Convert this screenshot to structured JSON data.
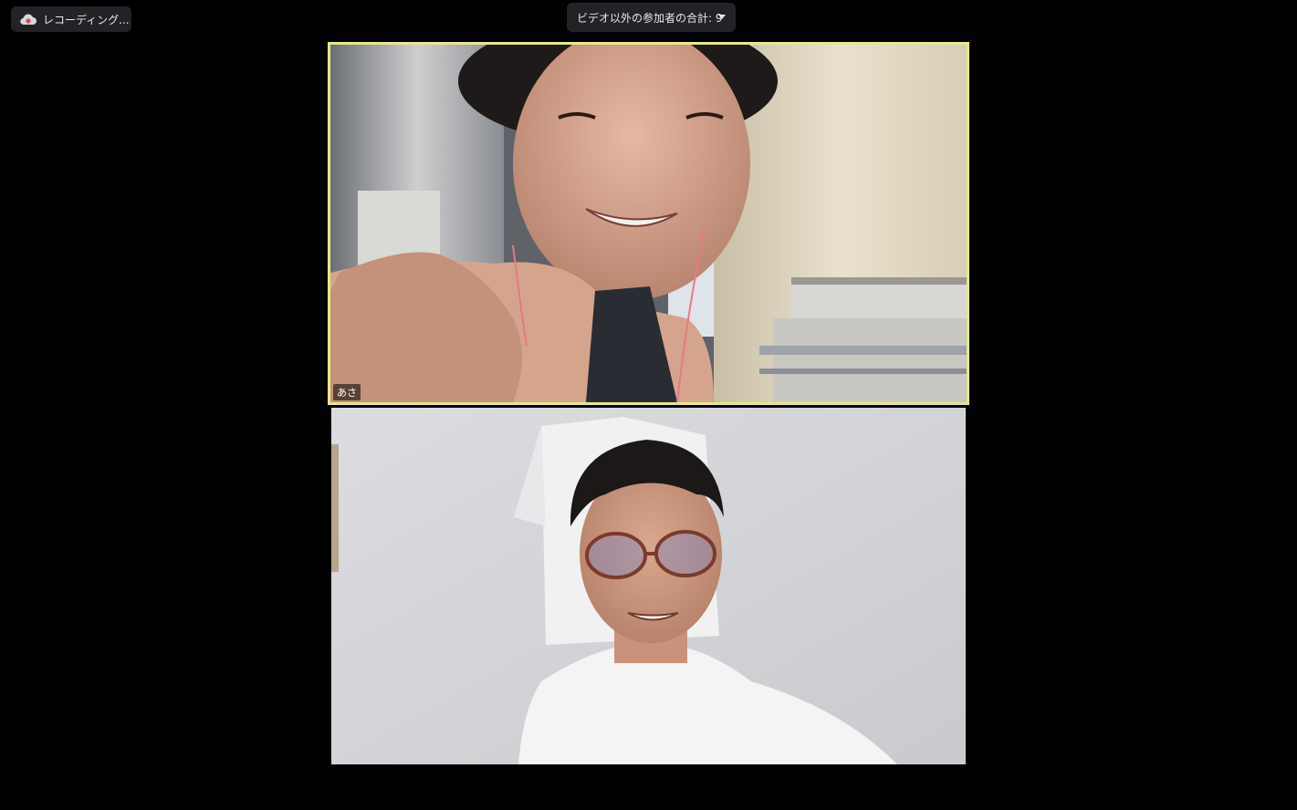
{
  "recording": {
    "label": "レコーディング...",
    "icon": "cloud-record-icon",
    "icon_color": "#e04a4a"
  },
  "participants": {
    "label": "ビデオ以外の参加者の合計: 9",
    "icon": "chevron-down-icon"
  },
  "tiles": [
    {
      "name": "あさ",
      "active_speaker": true,
      "highlight_color": "#e6e88a"
    },
    {
      "name": ""
    }
  ],
  "colors": {
    "background": "#000000",
    "pill_background": "#232327",
    "text": "#e8e8ea"
  }
}
